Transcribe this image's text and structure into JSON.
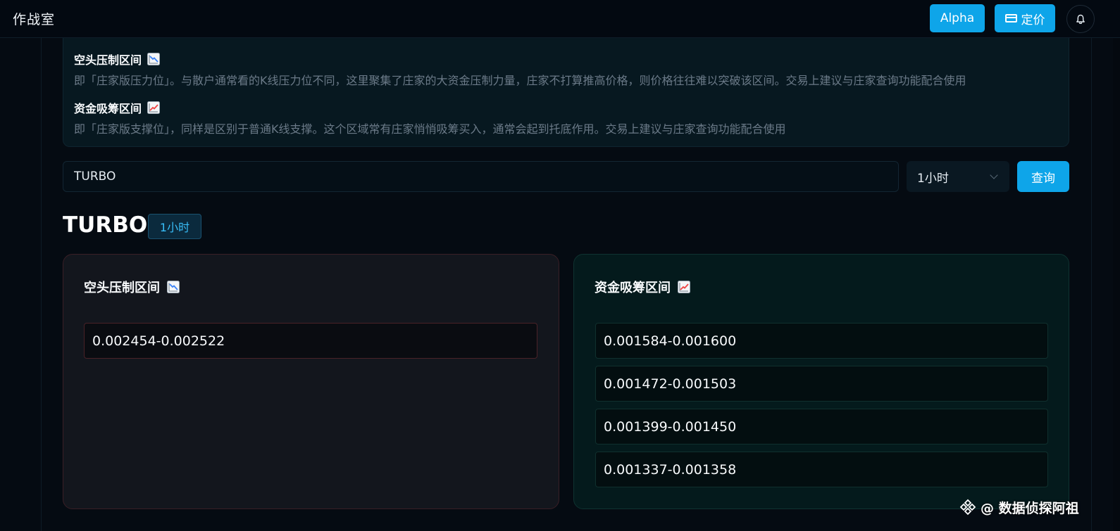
{
  "header": {
    "app_title": "作战室",
    "alpha_label": "Alpha",
    "pricing_label": "定价",
    "icons": {
      "pricing": "credit-card-icon",
      "notifications": "bell-icon"
    }
  },
  "legend": {
    "short_title": "空头压制区间",
    "short_desc": "即「庄家版压力位」。与散户通常看的K线压力位不同，这里聚集了庄家的大资金压制力量，庄家不打算推高价格，则价格往往难以突破该区间。交易上建议与庄家查询功能配合使用",
    "long_title": "资金吸筹区间",
    "long_desc": "即「庄家版支撑位」，同样是区别于普通K线支撑。这个区域常有庄家悄悄吸筹买入，通常会起到托底作用。交易上建议与庄家查询功能配合使用",
    "icons": {
      "short": "chart-decreasing-icon",
      "long": "chart-increasing-icon"
    }
  },
  "search": {
    "value": "TURBO",
    "interval_selected": "1小时",
    "query_label": "查询"
  },
  "result": {
    "symbol": "TURBO",
    "interval": "1小时",
    "short_panel": {
      "title": "空头压制区间",
      "ranges": [
        "0.002454-0.002522"
      ]
    },
    "long_panel": {
      "title": "资金吸筹区间",
      "ranges": [
        "0.001584-0.001600",
        "0.001472-0.001503",
        "0.001399-0.001450",
        "0.001337-0.001358"
      ]
    }
  },
  "watermark": {
    "text": "@ 数据侦探阿祖"
  },
  "colors": {
    "accent": "#0ea5e9",
    "background": "#050b12",
    "short_panel_border": "#3a1f26",
    "long_panel_background": "#041a1c"
  }
}
